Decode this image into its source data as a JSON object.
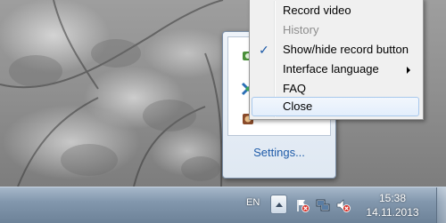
{
  "context_menu": {
    "items": [
      {
        "label": "Record video",
        "checked": false,
        "disabled": false,
        "submenu": false
      },
      {
        "label": "History",
        "checked": false,
        "disabled": true,
        "submenu": false
      },
      {
        "label": "Show/hide record button",
        "checked": true,
        "disabled": false,
        "submenu": false
      },
      {
        "label": "Interface language",
        "checked": false,
        "disabled": false,
        "submenu": true
      },
      {
        "label": "FAQ",
        "checked": false,
        "disabled": false,
        "submenu": false
      },
      {
        "label": "Close",
        "checked": false,
        "disabled": false,
        "submenu": false,
        "highlighted": true
      }
    ],
    "check_glyph": "✓"
  },
  "tray_popup": {
    "settings_label": "Settings...",
    "icons": [
      "recorder-app-icon",
      "network-tool-icon",
      "media-app-icon"
    ]
  },
  "taskbar": {
    "language": "EN",
    "clock_time": "15:38",
    "clock_date": "14.11.2013",
    "tray_icons": [
      "action-center-flag-icon",
      "network-icon",
      "volume-muted-icon"
    ]
  },
  "colors": {
    "accent": "#1e5ba8",
    "taskbar": "#8297ad",
    "menu_bg": "#f0f0f0",
    "disabled_text": "#8d8d8d",
    "error_red": "#d9342b"
  }
}
